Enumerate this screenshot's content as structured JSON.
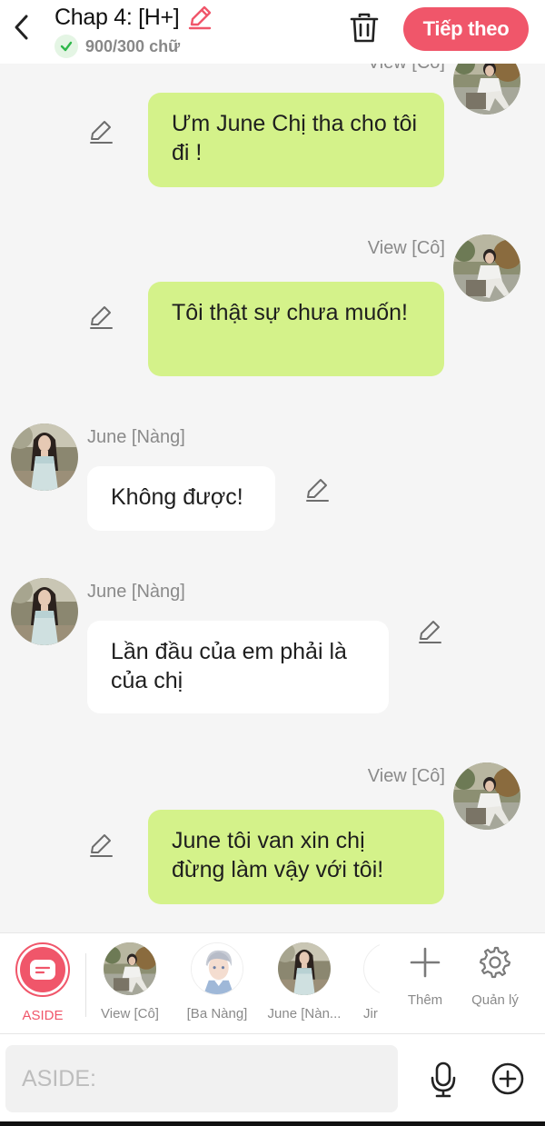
{
  "header": {
    "title": "Chap 4: [H+]",
    "word_count": "900/300 chữ",
    "next_label": "Tiếp theo",
    "accent": "#f0566a"
  },
  "messages": [
    {
      "sender": "View [Cô]",
      "text": "Ưm June Chị tha cho tôi đi !",
      "side": "right"
    },
    {
      "sender": "View [Cô]",
      "text": "Tôi thật sự chưa muốn!",
      "side": "right"
    },
    {
      "sender": "June [Nàng]",
      "text": "Không được!",
      "side": "left"
    },
    {
      "sender": "June [Nàng]",
      "text": "Lần đầu của em phải là của chị",
      "side": "left"
    },
    {
      "sender": "View [Cô]",
      "text": "June tôi van xin chị đừng làm vậy với tôi!",
      "side": "right"
    }
  ],
  "characters": [
    {
      "label": "ASIDE",
      "icon": "aside-icon"
    },
    {
      "label": "View [Cô]"
    },
    {
      "label": "[Ba Nàng]"
    },
    {
      "label": "June [Nàn..."
    },
    {
      "label": "Jir"
    }
  ],
  "tools": {
    "add_label": "Thêm",
    "manage_label": "Quản lý"
  },
  "input": {
    "placeholder": "ASIDE:",
    "value": ""
  },
  "colors": {
    "green_bubble": "#d4f28a",
    "white_bubble": "#ffffff",
    "background": "#f5f5f5"
  }
}
